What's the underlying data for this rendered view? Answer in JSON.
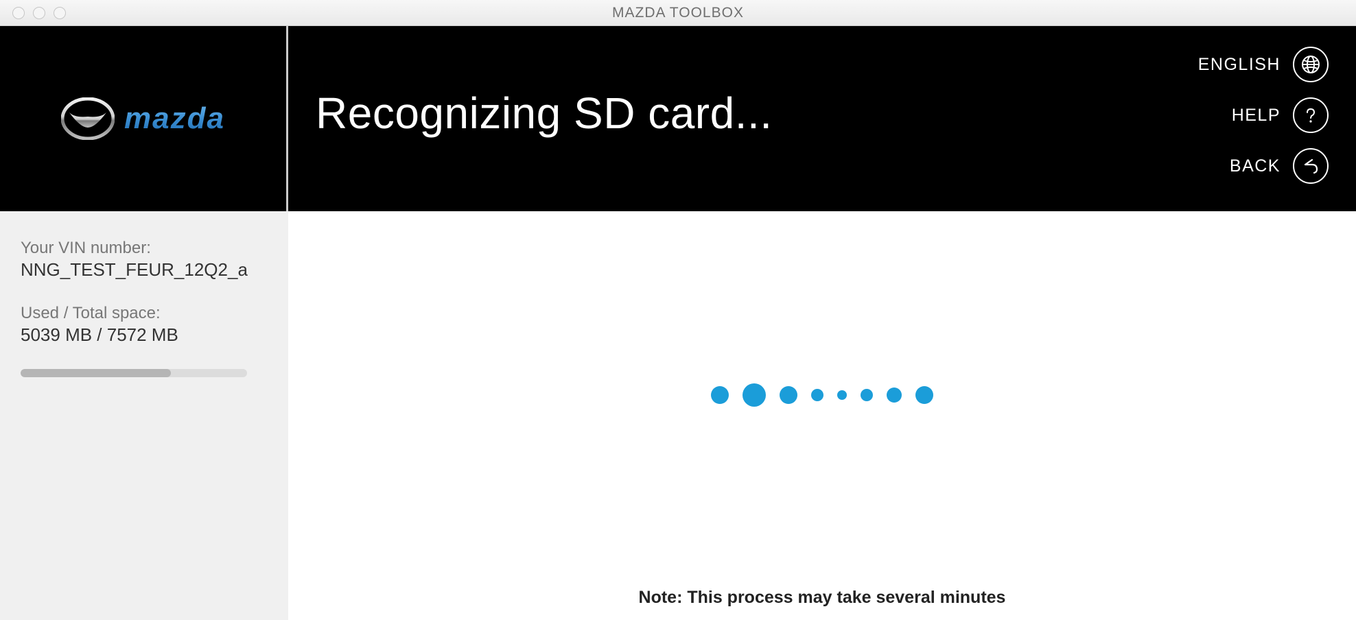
{
  "window": {
    "title": "MAZDA TOOLBOX"
  },
  "brand": {
    "name": "mazda"
  },
  "sidebar": {
    "vin_label": "Your VIN number:",
    "vin_value": "NNG_TEST_FEUR_12Q2_a",
    "space_label": "Used / Total space:",
    "space_value": "5039 MB / 7572 MB",
    "used_mb": 5039,
    "total_mb": 7572
  },
  "header": {
    "title": "Recognizing SD card...",
    "actions": {
      "language_label": "ENGLISH",
      "help_label": "HELP",
      "back_label": "BACK"
    }
  },
  "main": {
    "note": "Note: This process may take several minutes"
  },
  "colors": {
    "accent": "#1b9dd9",
    "header_bg": "#000000",
    "sidebar_bg": "#f0f0f0"
  },
  "loader_dot_sizes": [
    26,
    34,
    26,
    18,
    14,
    18,
    22,
    26
  ]
}
